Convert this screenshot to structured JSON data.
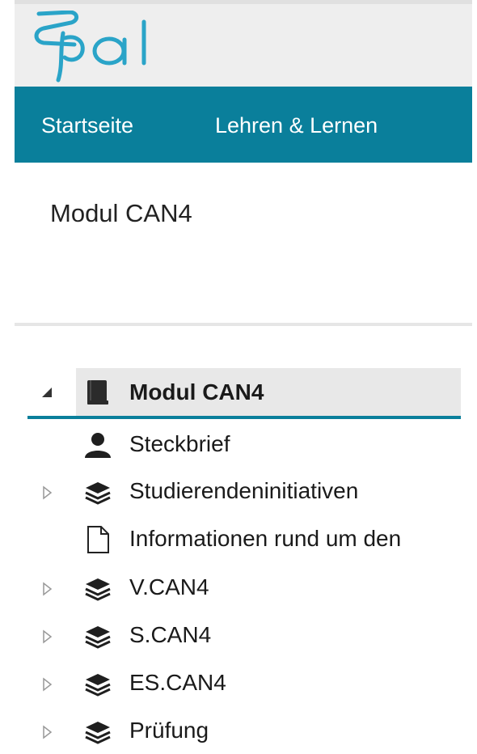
{
  "header": {
    "logo_text": "Opal",
    "brand_color": "#2aa4c8",
    "nav_color": "#0a7f9b"
  },
  "nav": {
    "items": [
      {
        "label": "Startseite"
      },
      {
        "label": "Lehren & Lernen"
      }
    ]
  },
  "course": {
    "title": "Modul CAN4"
  },
  "tree": {
    "root": {
      "label": "Modul CAN4",
      "icon": "book-icon",
      "expanded": true
    },
    "items": [
      {
        "label": "Steckbrief",
        "icon": "person-icon",
        "has_children": false
      },
      {
        "label": "Studierendeninitiativen",
        "icon": "layers-icon",
        "has_children": true
      },
      {
        "label": "Informationen rund um den",
        "icon": "document-icon",
        "has_children": false
      },
      {
        "label": "V.CAN4",
        "icon": "layers-icon",
        "has_children": true
      },
      {
        "label": "S.CAN4",
        "icon": "layers-icon",
        "has_children": true
      },
      {
        "label": "ES.CAN4",
        "icon": "layers-icon",
        "has_children": true
      },
      {
        "label": "Prüfung",
        "icon": "layers-icon",
        "has_children": true
      }
    ]
  }
}
